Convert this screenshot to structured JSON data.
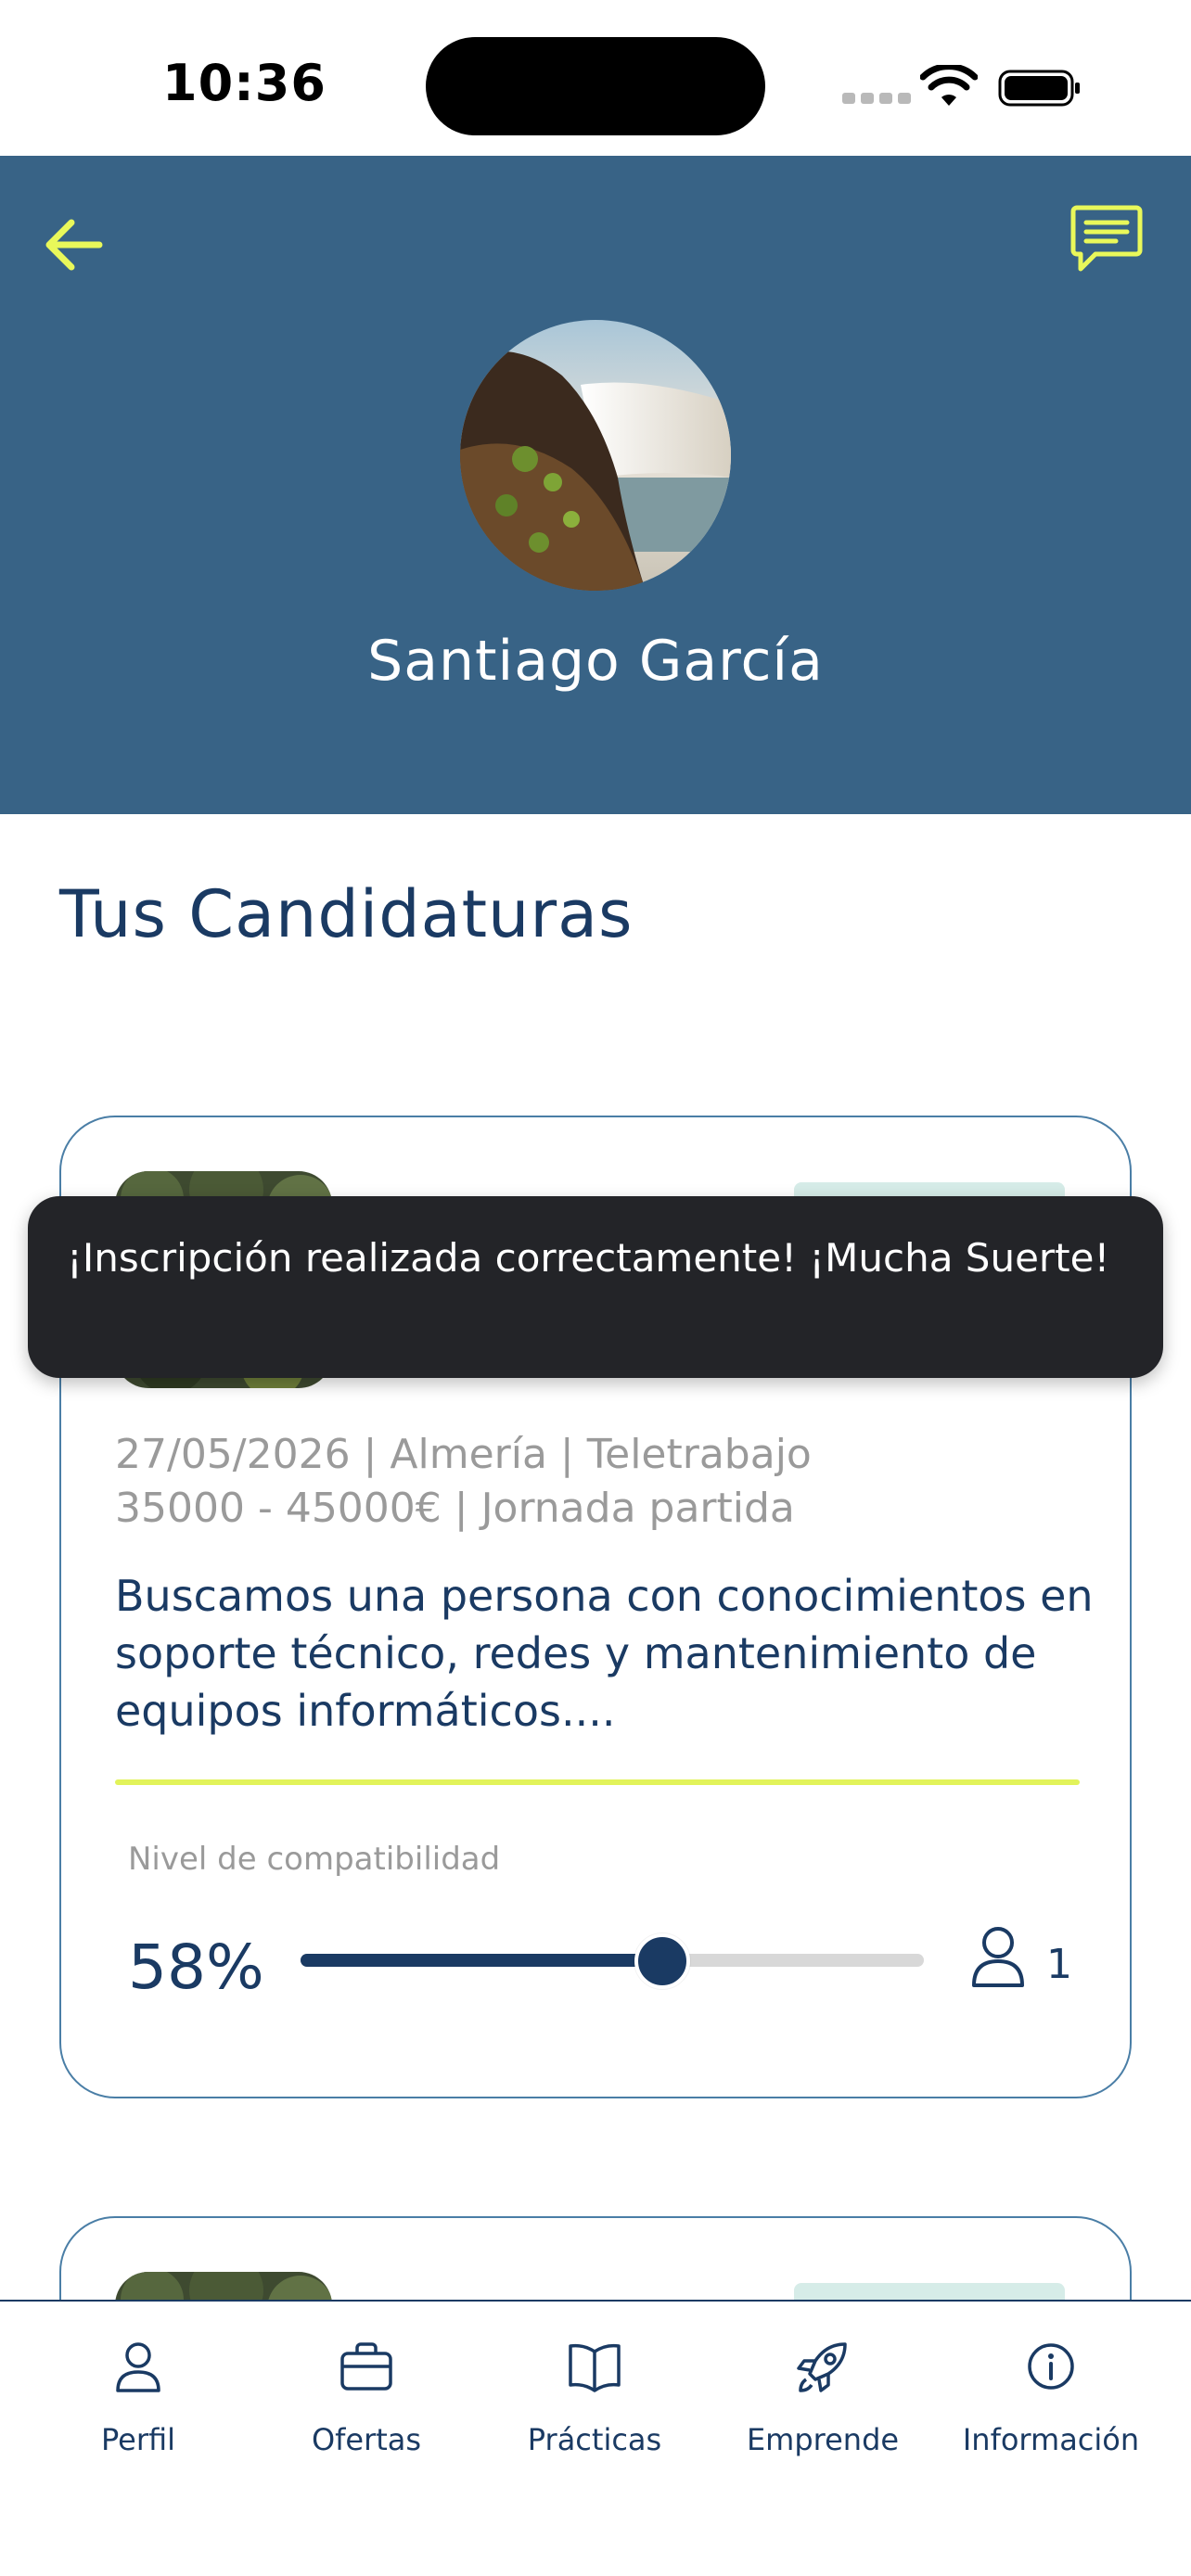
{
  "status_bar": {
    "time": "10:36"
  },
  "header": {
    "user_name": "Santiago García",
    "accent_color": "#E9F85A",
    "background_color": "#386386",
    "back_icon": "arrow-left-icon",
    "chat_icon": "chat-bubble-icon"
  },
  "page": {
    "section_title": "Tus Candidaturas"
  },
  "applications": [
    {
      "meta_line1": "27/05/2026 | Almería | Teletrabajo",
      "meta_line2": "35000 - 45000€ | Jornada partida",
      "description": "Buscamos una persona con conocimientos en soporte técnico, redes y mantenimiento de equipos informáticos....",
      "compat_label": "Nivel de compatibilidad",
      "compat_value": "58%",
      "compat_fraction": 0.58,
      "applicants_count": "1"
    }
  ],
  "toast": {
    "message": "¡Inscripción realizada correctamente! ¡Mucha Suerte!"
  },
  "bottom_nav": {
    "items": [
      {
        "label": "Perfil",
        "icon": "user-icon"
      },
      {
        "label": "Ofertas",
        "icon": "briefcase-icon"
      },
      {
        "label": "Prácticas",
        "icon": "book-icon"
      },
      {
        "label": "Emprende",
        "icon": "rocket-icon"
      },
      {
        "label": "Información",
        "icon": "info-icon"
      }
    ]
  }
}
